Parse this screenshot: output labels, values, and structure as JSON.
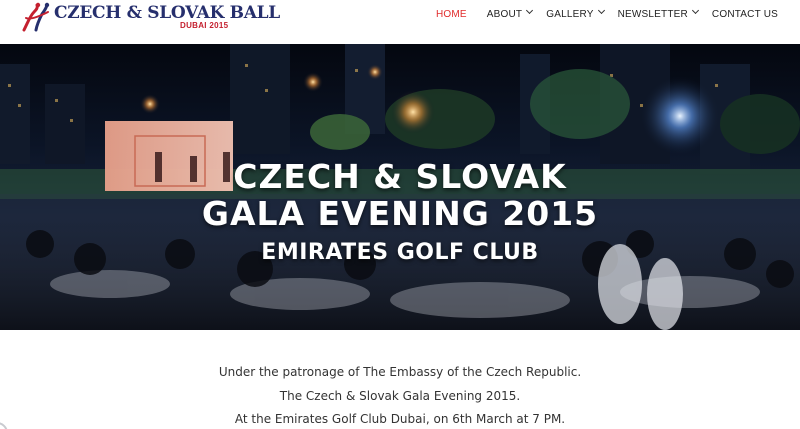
{
  "logo": {
    "title": "CZECH & SLOVAK BALL",
    "subtitle": "DUBAI 2015"
  },
  "nav": {
    "items": [
      {
        "label": "HOME",
        "active": true,
        "dropdown": false
      },
      {
        "label": "ABOUT",
        "active": false,
        "dropdown": true
      },
      {
        "label": "GALLERY",
        "active": false,
        "dropdown": true
      },
      {
        "label": "NEWSLETTER",
        "active": false,
        "dropdown": true
      },
      {
        "label": "CONTACT US",
        "active": false,
        "dropdown": false
      }
    ]
  },
  "hero": {
    "title_line1": "CZECH & SLOVAK",
    "title_line2": "GALA EVENING 2015",
    "venue": "EMIRATES GOLF CLUB"
  },
  "content": {
    "line1": "Under the patronage of The Embassy of the Czech Republic.",
    "line2": "The Czech & Slovak Gala Evening 2015.",
    "line3": "At the Emirates Golf Club Dubai, on 6th March at 7 PM."
  },
  "colors": {
    "brand_navy": "#262f6d",
    "brand_red": "#c4202f",
    "nav_active": "#e02b2b"
  }
}
